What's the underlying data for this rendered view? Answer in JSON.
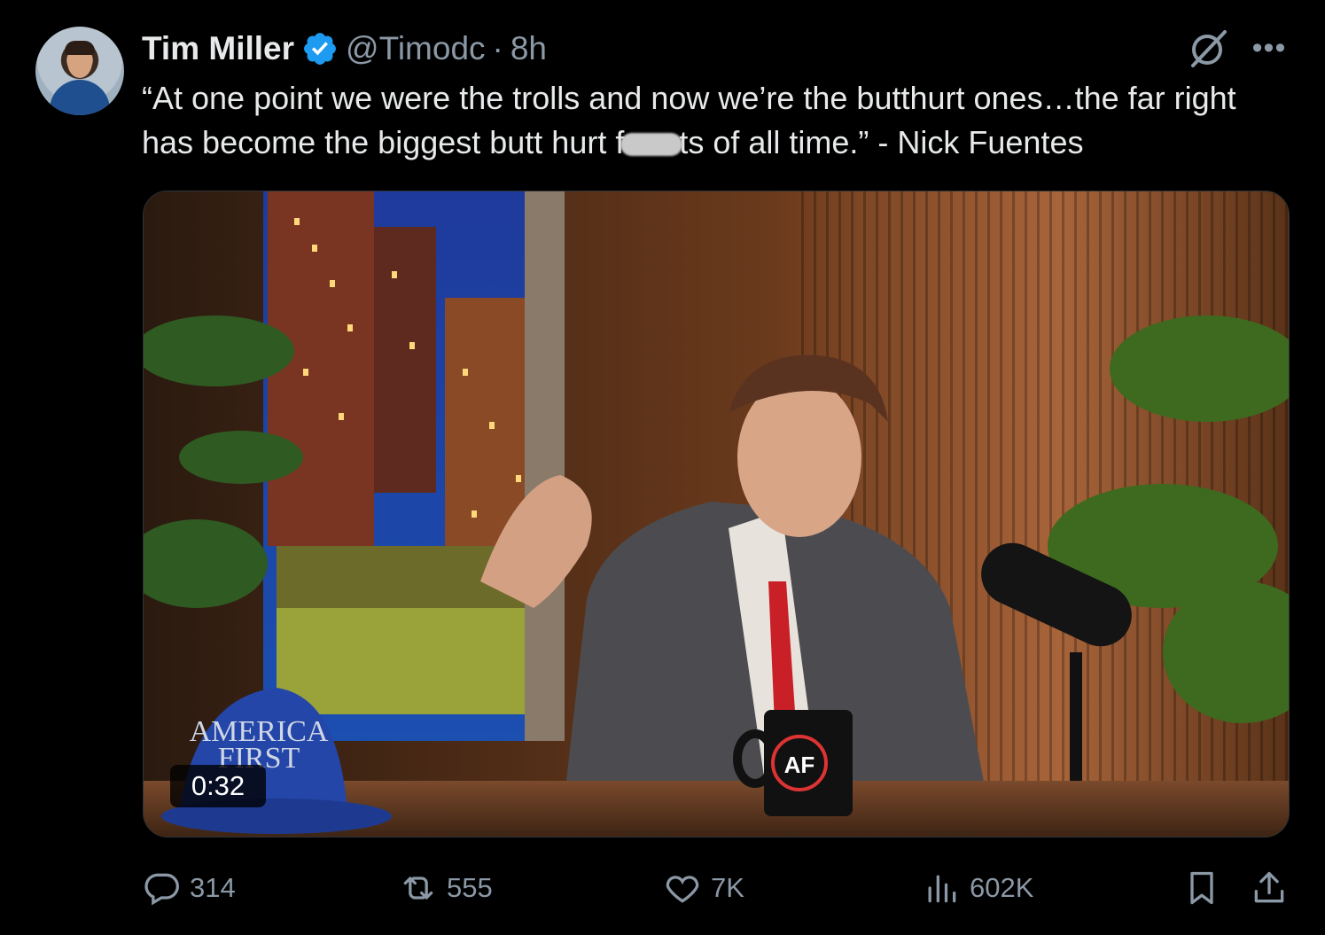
{
  "author": {
    "name": "Tim Miller",
    "handle": "@Timodc",
    "separator": "·",
    "time": "8h",
    "verified": true
  },
  "tweet": {
    "text_part1": "“At one point we were the trolls and now we’re the butthurt ones…the far right has become the biggest butt hurt f",
    "text_part2": "ts of all time.” - Nick Fuentes"
  },
  "media": {
    "duration": "0:32",
    "hat_text_line1": "AMERICA",
    "hat_text_line2": "FIRST",
    "mug_logo": "AF"
  },
  "actions": {
    "replies": "314",
    "reposts": "555",
    "likes": "7K",
    "views": "602K"
  },
  "colors": {
    "background": "#000000",
    "text": "#e7e9ea",
    "muted": "#8b98a5",
    "verified": "#1d9bf0"
  },
  "icons": [
    "reply-icon",
    "repost-icon",
    "like-icon",
    "views-icon",
    "bookmark-icon",
    "share-icon",
    "grok-icon",
    "more-icon",
    "verified-badge-icon"
  ]
}
